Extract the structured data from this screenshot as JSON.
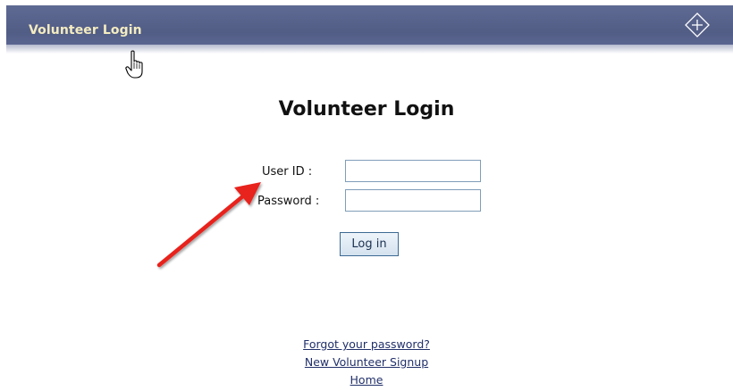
{
  "header": {
    "title": "Volunteer Login",
    "expand_icon": "plus-diamond-icon",
    "background_color": "#56618a",
    "title_color": "#f4ecc0"
  },
  "main": {
    "title": "Volunteer Login",
    "user_id_label": "User ID :",
    "password_label": "Password :",
    "user_id_value": "",
    "password_value": "",
    "login_button_label": "Log in"
  },
  "links": {
    "forgot_password": "Forgot your password?",
    "new_signup": "New Volunteer Signup",
    "home": "Home"
  },
  "annotations": {
    "arrow_color": "#e8221b",
    "cursor_icon": "hand-pointer-icon"
  }
}
